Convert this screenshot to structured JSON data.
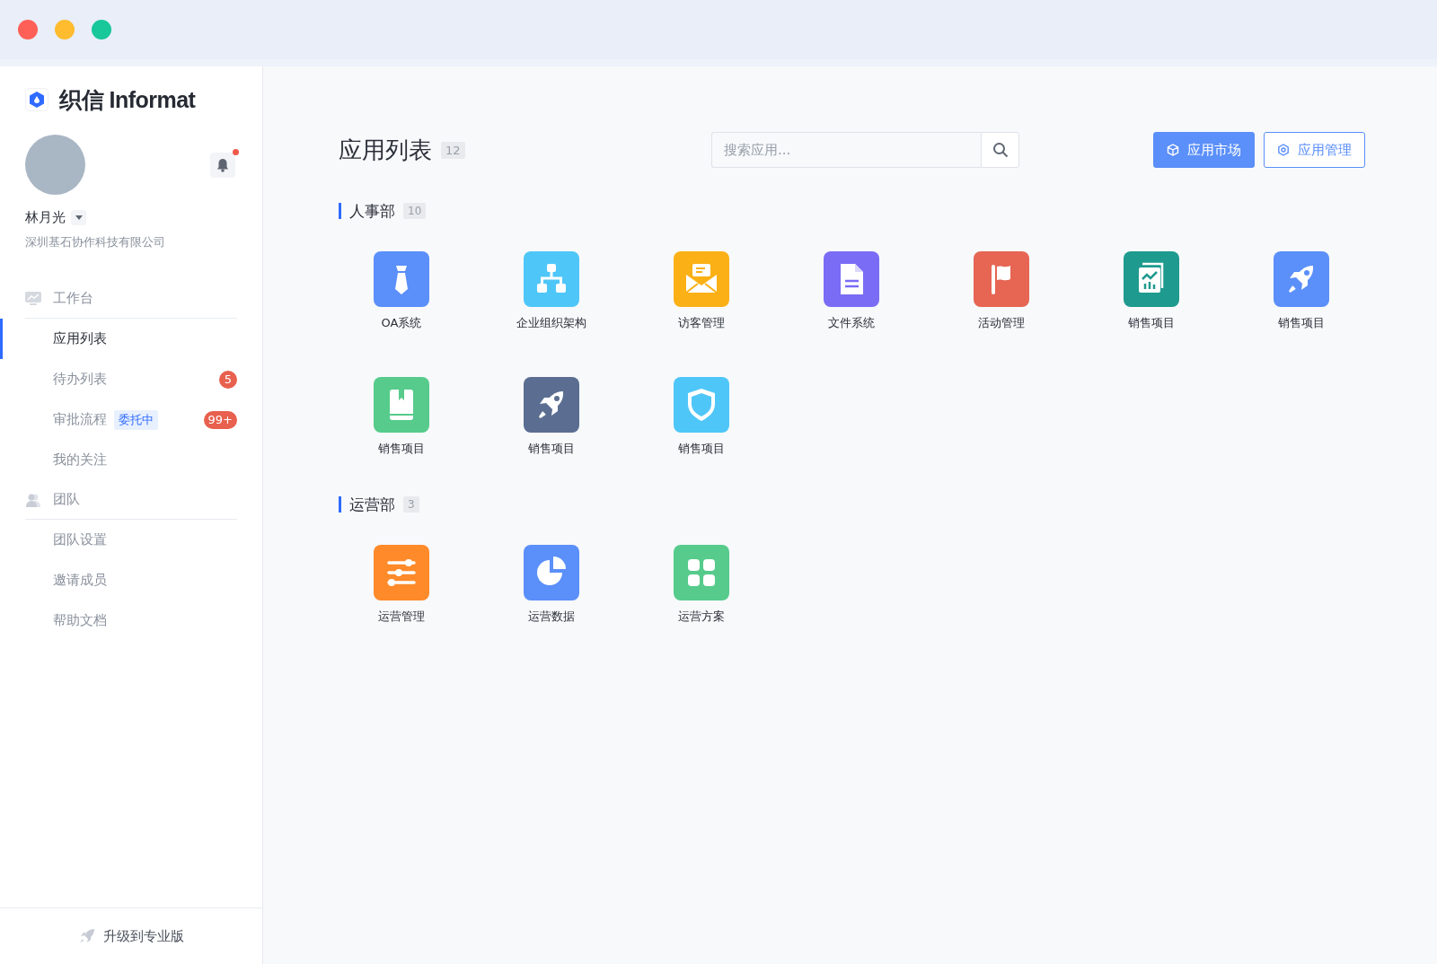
{
  "window": {
    "controls": [
      {
        "color": "#fe5f57"
      },
      {
        "color": "#febc2e"
      },
      {
        "color": "#18c79a"
      }
    ]
  },
  "sidebar": {
    "brand": "织信 Informat",
    "user": {
      "name": "林月光",
      "company": "深圳基石协作科技有限公司",
      "notification_unread": true
    },
    "nav_groups": [
      {
        "label": "工作台",
        "items": [
          {
            "label": "应用列表",
            "selected": true
          },
          {
            "label": "待办列表",
            "selected": false,
            "badge": "5"
          },
          {
            "label": "审批流程",
            "selected": false,
            "tag": "委托中",
            "badge": "99+"
          },
          {
            "label": "我的关注",
            "selected": false
          }
        ]
      },
      {
        "label": "团队",
        "items": [
          {
            "label": "团队设置",
            "selected": false
          },
          {
            "label": "邀请成员",
            "selected": false
          },
          {
            "label": "帮助文档",
            "selected": false
          }
        ]
      }
    ],
    "upgrade": "升级到专业版"
  },
  "main": {
    "title": "应用列表",
    "count": "12",
    "search": {
      "placeholder": "搜索应用..."
    },
    "buttons": [
      {
        "label": "应用市场",
        "kind": "primary"
      },
      {
        "label": "应用管理",
        "kind": "outline"
      }
    ],
    "sections": [
      {
        "title": "人事部",
        "count": "10",
        "apps": [
          {
            "name": "OA系统",
            "kind": "tie",
            "color": "#5b8ff9"
          },
          {
            "name": "企业组织架构",
            "kind": "org",
            "color": "#4fc6f8"
          },
          {
            "name": "访客管理",
            "kind": "mail",
            "color": "#fbb016"
          },
          {
            "name": "文件系统",
            "kind": "file",
            "color": "#7a6cf5"
          },
          {
            "name": "活动管理",
            "kind": "flag",
            "color": "#e66553"
          },
          {
            "name": "销售项目",
            "kind": "chart",
            "color": "#1e9a8e"
          },
          {
            "name": "销售项目",
            "kind": "rocket",
            "color": "#5b8ff9"
          },
          {
            "name": "销售项目",
            "kind": "book",
            "color": "#56cb8b"
          },
          {
            "name": "销售项目",
            "kind": "rocket",
            "color": "#5b6e91"
          },
          {
            "name": "销售项目",
            "kind": "shield",
            "color": "#4fc6f8"
          }
        ]
      },
      {
        "title": "运营部",
        "count": "3",
        "apps": [
          {
            "name": "运营管理",
            "kind": "sliders",
            "color": "#ff8a2a"
          },
          {
            "name": "运营数据",
            "kind": "pie",
            "color": "#5b8ff9"
          },
          {
            "name": "运营方案",
            "kind": "grid",
            "color": "#56cb8b"
          }
        ]
      }
    ]
  }
}
